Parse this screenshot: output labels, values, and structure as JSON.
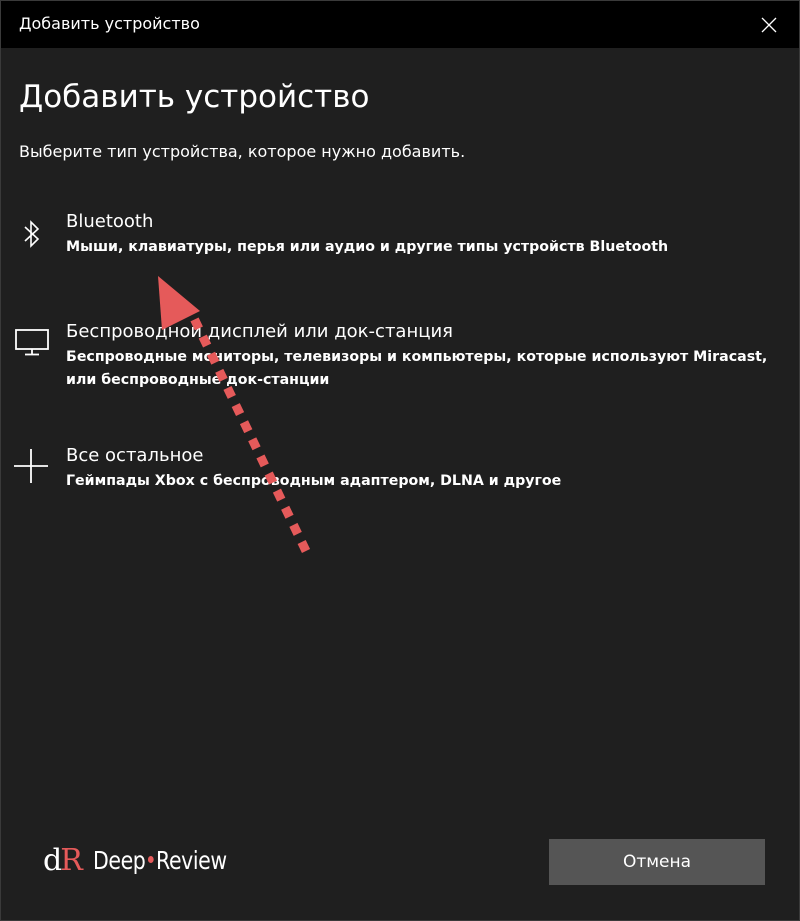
{
  "window": {
    "title": "Добавить устройство"
  },
  "page": {
    "heading": "Добавить устройство",
    "subtitle": "Выберите тип устройства, которое нужно добавить."
  },
  "options": [
    {
      "icon": "bluetooth-icon",
      "title": "Bluetooth",
      "description": "Мыши, клавиатуры, перья или аудио и другие типы устройств Bluetooth"
    },
    {
      "icon": "monitor-icon",
      "title": "Беспроводной дисплей или док-станция",
      "description": "Беспроводные мониторы, телевизоры и компьютеры, которые используют Miracast, или беспроводные док-станции"
    },
    {
      "icon": "plus-icon",
      "title": "Все остальное",
      "description": "Геймпады Xbox с беспроводным адаптером, DLNA и другое"
    }
  ],
  "footer": {
    "cancel_label": "Отмена",
    "logo_text_left": "Deep",
    "logo_text_right": "Review"
  },
  "colors": {
    "background": "#1f1f1f",
    "titlebar": "#000000",
    "button": "#555555",
    "annotation_arrow": "#e55a5a"
  }
}
